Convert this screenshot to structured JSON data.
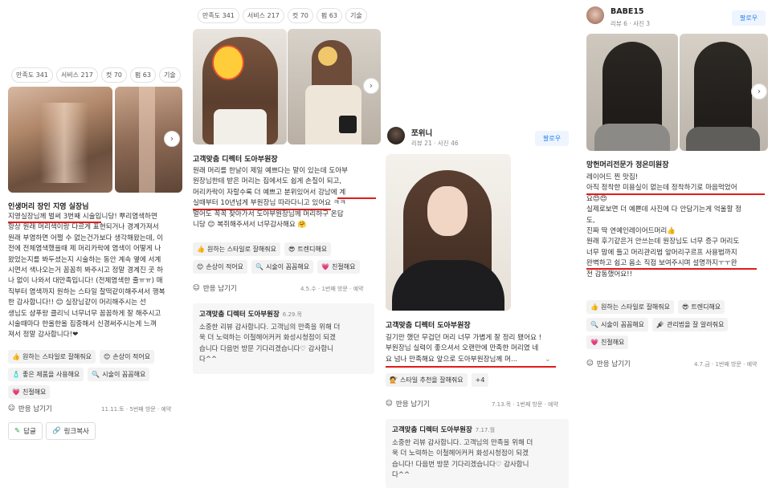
{
  "chips": [
    "만족도 341",
    "서비스 217",
    "컷 70",
    "펌 63",
    "기술"
  ],
  "react_label": "반응 남기기",
  "reply_body": [
    "소중한 리뷰 감사합니다. 고객님의 만족을 위해 더",
    "욱 더 노력하는 이철헤어커커 화성시청점이 되겠",
    "습니다 다음번 방문 기다리겠습니다♡ 감사합니",
    "다^^"
  ],
  "reply_body2": [
    "소중한 리뷰 감사합니다. 고객님의 만족을 위해 더",
    "욱 더 노력하는 이철헤어커커 화성시청점이 되겠",
    "습니다! 다음번 방문 기다리겠습니다♡ 감사합니",
    "다^^"
  ],
  "col1": {
    "shop": "인생머리 장인 지영 실장님",
    "lines": [
      "지영실장님께 벌써 3번째 시술입니당! 뿌리염색하면",
      "항상 원래 머리색이랑 다르게 표현되거나 경계가져서",
      "원래 부염하면 어쩔 수 없는건가보다 생각해왔는데, 이",
      "전에 전체염색했을때 제 머리카락에 염색이 어떻게 나",
      "왔었는지를 봐두셨는지 시술하는 동안 계속 옆에 서계",
      "시면서 색나오는거 꼼꼼히 봐주시고 정말 경계진 곳 하",
      "나 없이 나와서 대만족입니다! (전체염색한 줄ㅠㅠ) 매",
      "직부터 염색까지 원하는 스타일 찰떡같이해주셔서 행복",
      "한 감사합니다!! 😊 실장님같이 머리해주시는 선",
      "생님도 샴푸랑 클리닉 너무너무 꼼꼼하게 잘 해주시고",
      "시술때마다 한올한올 집중해서 신경써주시는게 느껴",
      "져서 정말 감사합니다!❤"
    ],
    "tags": [
      {
        "icon": "thumbs-up-icon",
        "glyph": "👍",
        "label": "원하는 스타일로 잘해줘요"
      },
      {
        "icon": "smile-icon",
        "glyph": "😊",
        "label": "손상이 적어요"
      },
      {
        "icon": "bottle-icon",
        "glyph": "🧴",
        "label": "좋은 제품을 사용해요"
      },
      {
        "icon": "magnifier-icon",
        "glyph": "🔍",
        "label": "시술이 꼼꼼해요"
      },
      {
        "icon": "heart-icon",
        "glyph": "💗",
        "label": "친절해요"
      }
    ],
    "meta": "11.11.토 · 5번째 방문 · 예약",
    "reply_btn": "답글",
    "link_btn": "링크복사"
  },
  "col2": {
    "shop": "고객맞춤 디렉터 도아부원장",
    "lines": [
      "원래 머리를 한날이 제일 예쁘다는 말이 있는데 도아부",
      "원장님한테 받은 머리는 집에서도 쉽게 손질이 되고,",
      "머리카락이 자랄수록 더 예쁘고 분위있어서 강남에 계",
      "실때부터 10년넘게 부원장님 따라다니고 있어요 ㅋㅋ",
      "멀어도 꼭꼭 찾아가서 도아부원장님께 머리하구 온답",
      "니당 😊 복쥐해주셔서 너무감사해요 🤗"
    ],
    "tags": [
      {
        "icon": "thumbs-up-icon",
        "glyph": "👍",
        "label": "원하는 스타일로 잘해줘요"
      },
      {
        "icon": "sunglasses-icon",
        "glyph": "😎",
        "label": "트렌디해요"
      },
      {
        "icon": "smile-icon",
        "glyph": "😊",
        "label": "손상이 적어요"
      },
      {
        "icon": "magnifier-icon",
        "glyph": "🔍",
        "label": "시술이 꼼꼼해요"
      },
      {
        "icon": "heart-icon",
        "glyph": "💗",
        "label": "친절해요"
      }
    ],
    "meta": "4.5.수 · 1번째 방문 · 예약",
    "reply_shop": "고객맞춤 디렉터 도아부원장",
    "reply_date": "6.29.목"
  },
  "col3": {
    "user": "쪼위니",
    "stats": "리뷰 21 · 사진 46",
    "follow": "팔로우",
    "shop": "고객맞춤 디렉터 도아부원장",
    "lines": [
      "길기만 했던 무겁던 머리 너무 가볍게 잘 정리 됐어요 !",
      "부원장님 실력이 좋으셔서 오랜만에 만족한 머리였 네",
      "요 넘나 만족해요 앞으로 도아부원장님께 머..."
    ],
    "tags": [
      {
        "icon": "hair-icon",
        "glyph": "💇",
        "label": "스타일 추천을 잘해줘요"
      },
      {
        "icon": "more-icon",
        "glyph": "",
        "label": "+4"
      }
    ],
    "meta": "7.13.목 · 1번째 방문 · 예약",
    "reply_shop": "고객맞춤 디렉터 도아부원장",
    "reply_date": "7.17.월"
  },
  "col4": {
    "user": "BABE15",
    "stats": "리뷰 6 · 사진 3",
    "follow": "팔로우",
    "shop": "망헌머리전문가 정은미원장",
    "lines": [
      "레이어드 찐 맛집!",
      "아직 정착한 미용실이 없는데 정착하기로 마음먹었어",
      "요😍😍",
      "실제로보면 더 예쁜데 사진에 다 안담기는게 억울할 정",
      "도,",
      "진짜 딱 연예인레이어드머리👍",
      "원래 후기같은거 안쓰는데 원장님도 너무 증구 머리도",
      "너무 맘에 들고 머리관리법 앞머리구르프 사용법까지",
      "완벽하고 쉽고 옴소 직접 보여주시며 설명까지ㅜㅜ완",
      "전 감동했어요!!"
    ],
    "tags": [
      {
        "icon": "thumbs-up-icon",
        "glyph": "👍",
        "label": "원하는 스타일로 잘해줘요"
      },
      {
        "icon": "sunglasses-icon",
        "glyph": "😎",
        "label": "트렌디해요"
      },
      {
        "icon": "magnifier-icon",
        "glyph": "🔍",
        "label": "시술이 꼼꼼해요"
      },
      {
        "icon": "comb-icon",
        "glyph": "🪮",
        "label": "관리법을 잘 알려줘요"
      },
      {
        "icon": "heart-icon",
        "glyph": "💗",
        "label": "친절해요"
      }
    ],
    "meta": "4.7.금 · 1번째 방문 · 예약"
  }
}
